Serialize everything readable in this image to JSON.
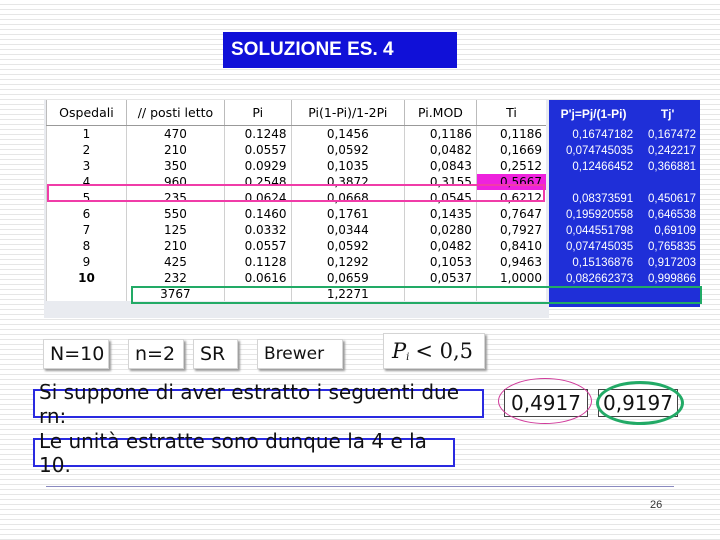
{
  "title": "SOLUZIONE ES. 4",
  "table": {
    "headers": [
      "Ospedali",
      "// posti letto",
      "Pi",
      "Pi(1-Pi)/1-2Pi",
      "Pi.MOD",
      "Ti"
    ],
    "rows": [
      [
        "1",
        "470",
        "0.1248",
        "0,1456",
        "0,1186",
        "0,1186"
      ],
      [
        "2",
        "210",
        "0.0557",
        "0,0592",
        "0,0482",
        "0,1669"
      ],
      [
        "3",
        "350",
        "0.0929",
        "0,1035",
        "0,0843",
        "0,2512"
      ],
      [
        "4",
        "960",
        "0.2548",
        "0,3872",
        "0,3155",
        "0,5667"
      ],
      [
        "5",
        "235",
        "0.0624",
        "0,0668",
        "0,0545",
        "0,6212"
      ],
      [
        "6",
        "550",
        "0.1460",
        "0,1761",
        "0,1435",
        "0,7647"
      ],
      [
        "7",
        "125",
        "0.0332",
        "0,0344",
        "0,0280",
        "0,7927"
      ],
      [
        "8",
        "210",
        "0.0557",
        "0,0592",
        "0,0482",
        "0,8410"
      ],
      [
        "9",
        "425",
        "0.1128",
        "0,1292",
        "0,1053",
        "0,9463"
      ],
      [
        "10",
        "232",
        "0.0616",
        "0,0659",
        "0,0537",
        "1,0000"
      ]
    ],
    "totals": [
      "",
      "3767",
      "",
      "1,2271",
      "",
      ""
    ]
  },
  "side_table": {
    "headers": [
      "P'j=Pj/(1-Pi)",
      "Tj'"
    ],
    "rows": [
      [
        "0,16747182",
        "0,167472"
      ],
      [
        "0,074745035",
        "0,242217"
      ],
      [
        "0,12466452",
        "0,366881"
      ],
      [
        "",
        ""
      ],
      [
        "0,08373591",
        "0,450617"
      ],
      [
        "0,195920558",
        "0,646538"
      ],
      [
        "0,044551798",
        "0,69109"
      ],
      [
        "0,074745035",
        "0,765835"
      ],
      [
        "0,15136876",
        "0,917203"
      ],
      [
        "0,082662373",
        "0,999866"
      ]
    ]
  },
  "chips": {
    "N": "N=10",
    "n": "n=2",
    "method": "SR",
    "brewer": "Brewer",
    "condition_var": "P",
    "condition_sub": "i",
    "condition_rest": "< 0,5"
  },
  "sentence1": "Si suppone di aver estratto i seguenti due rn:",
  "rn1": "0,4917",
  "rn2": "0,9197",
  "sentence2": "Le unità estratte sono dunque la 4 e la 10.",
  "page_number": "26",
  "colors": {
    "title_bg": "#1010d8",
    "highlight_cell": "#ee22dd",
    "side_panel": "#1f2fd8",
    "pink_outline": "#f03ca8",
    "green_outline": "#22aa66"
  }
}
